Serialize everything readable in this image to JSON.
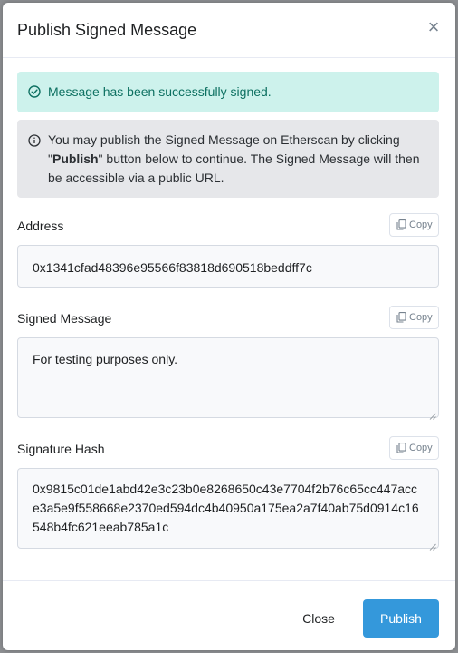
{
  "modal": {
    "title": "Publish Signed Message",
    "close_symbol": "×"
  },
  "alerts": {
    "success": {
      "icon": "check-circle-icon",
      "text": "Message has been successfully signed.",
      "color": "#cdf2ec"
    },
    "info": {
      "icon": "info-circle-icon",
      "prefix": "You may publish the Signed Message on Etherscan by clicking \"",
      "bold": "Publish",
      "suffix": "\" button below to continue. The Signed Message will then be accessible via a public URL.",
      "color": "#e6e7ea"
    }
  },
  "fields": {
    "address": {
      "label": "Address",
      "copy_label": "Copy",
      "value": "0x1341cfad48396e95566f83818d690518beddff7c"
    },
    "signed_message": {
      "label": "Signed Message",
      "copy_label": "Copy",
      "value": "For testing purposes only."
    },
    "signature_hash": {
      "label": "Signature Hash",
      "copy_label": "Copy",
      "value": "0x9815c01de1abd42e3c23b0e8268650c43e7704f2b76c65cc447acce3a5e9f558668e2370ed594dc4b40950a175ea2a7f40ab75d0914c16548b4fc621eeab785a1c"
    }
  },
  "footer": {
    "close_label": "Close",
    "publish_label": "Publish",
    "publish_color": "#3498db"
  }
}
